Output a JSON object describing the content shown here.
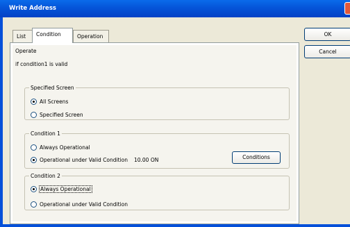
{
  "window": {
    "title": "Write Address"
  },
  "tabs": [
    {
      "label": "List"
    },
    {
      "label": "Condition"
    },
    {
      "label": "Operation"
    }
  ],
  "operate": {
    "heading": "Operate",
    "summary": "if condition1 is valid"
  },
  "specified_screen": {
    "legend": "Specified Screen",
    "options": [
      {
        "label": "All Screens",
        "checked": true
      },
      {
        "label": "Specified Screen",
        "checked": false
      }
    ]
  },
  "condition1": {
    "legend": "Condition 1",
    "options": [
      {
        "label": "Always Operational",
        "checked": false
      },
      {
        "label": "Operational under Valid Condition",
        "checked": true
      }
    ],
    "value": "10.00 ON",
    "button_label": "Conditions"
  },
  "condition2": {
    "legend": "Condition 2",
    "options": [
      {
        "label": "Always Operational",
        "checked": true
      },
      {
        "label": "Operational under Valid Condition",
        "checked": false
      }
    ]
  },
  "buttons": {
    "ok": "OK",
    "cancel": "Cancel"
  }
}
